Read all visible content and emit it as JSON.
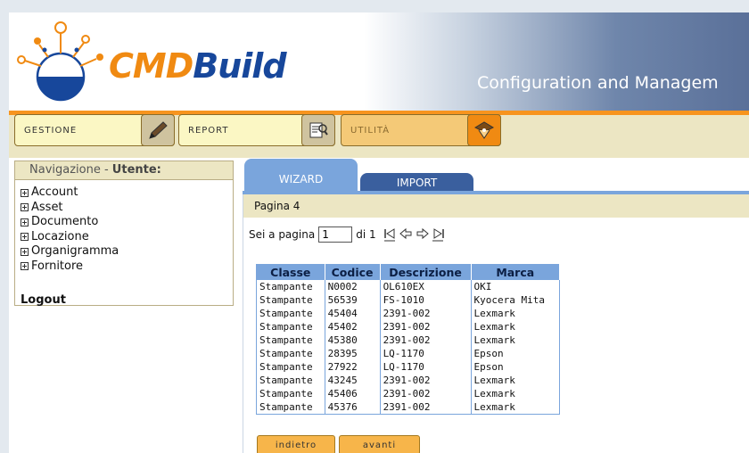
{
  "header": {
    "brand_cmd": "CMD",
    "brand_build": "Build",
    "tagline": "Configuration and Managem"
  },
  "menu": [
    {
      "label": "GESTIONE",
      "icon": "pen-icon"
    },
    {
      "label": "REPORT",
      "icon": "report-search-icon"
    },
    {
      "label": "UTILITÀ",
      "icon": "tools-icon"
    }
  ],
  "nav": {
    "title_prefix": "Navigazione - ",
    "title_user": "Utente:",
    "items": [
      "Account",
      "Asset",
      "Documento",
      "Locazione",
      "Organigramma",
      "Fornitore"
    ],
    "logout": "Logout"
  },
  "tabs": {
    "wizard": "WIZARD",
    "import": "IMPORT"
  },
  "page": {
    "heading": "Pagina 4",
    "pager_prefix": "Sei a pagina",
    "pager_value": "1",
    "pager_suffix": "di 1"
  },
  "table": {
    "headers": [
      "Classe",
      "Codice",
      "Descrizione",
      "Marca"
    ],
    "rows": [
      [
        "Stampante",
        "N0002",
        "OL610EX",
        "OKI"
      ],
      [
        "Stampante",
        "56539",
        "FS-1010",
        "Kyocera Mita"
      ],
      [
        "Stampante",
        "45404",
        "2391-002",
        "Lexmark"
      ],
      [
        "Stampante",
        "45402",
        "2391-002",
        "Lexmark"
      ],
      [
        "Stampante",
        "45380",
        "2391-002",
        "Lexmark"
      ],
      [
        "Stampante",
        "28395",
        "LQ-1170",
        "Epson"
      ],
      [
        "Stampante",
        "27922",
        "LQ-1170",
        "Epson"
      ],
      [
        "Stampante",
        "43245",
        "2391-002",
        "Lexmark"
      ],
      [
        "Stampante",
        "45406",
        "2391-002",
        "Lexmark"
      ],
      [
        "Stampante",
        "45376",
        "2391-002",
        "Lexmark"
      ]
    ]
  },
  "buttons": {
    "back": "indietro",
    "next": "avanti"
  }
}
